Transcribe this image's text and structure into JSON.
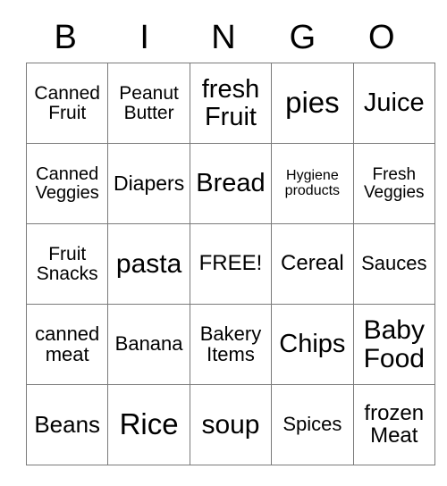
{
  "header": {
    "letters": [
      "B",
      "I",
      "N",
      "G",
      "O"
    ]
  },
  "grid": {
    "rows": [
      [
        {
          "label": "Canned\nFruit",
          "size": "fs-21"
        },
        {
          "label": "Peanut\nButter",
          "size": "fs-21"
        },
        {
          "label": "fresh\nFruit",
          "size": "fs-29"
        },
        {
          "label": "pies",
          "size": "fs-33"
        },
        {
          "label": "Juice",
          "size": "fs-29"
        }
      ],
      [
        {
          "label": "Canned\nVeggies",
          "size": "fs-20"
        },
        {
          "label": "Diapers",
          "size": "fs-23"
        },
        {
          "label": "Bread",
          "size": "fs-29"
        },
        {
          "label": "Hygiene\nproducts",
          "size": "fs-16"
        },
        {
          "label": "Fresh\nVeggies",
          "size": "fs-19"
        }
      ],
      [
        {
          "label": "Fruit\nSnacks",
          "size": "fs-21"
        },
        {
          "label": "pasta",
          "size": "fs-30"
        },
        {
          "label": "FREE!",
          "size": "fs-24"
        },
        {
          "label": "Cereal",
          "size": "fs-24"
        },
        {
          "label": "Sauces",
          "size": "fs-22"
        }
      ],
      [
        {
          "label": "canned\nmeat",
          "size": "fs-22"
        },
        {
          "label": "Banana",
          "size": "fs-22"
        },
        {
          "label": "Bakery\nItems",
          "size": "fs-22"
        },
        {
          "label": "Chips",
          "size": "fs-29"
        },
        {
          "label": "Baby\nFood",
          "size": "fs-30"
        }
      ],
      [
        {
          "label": "Beans",
          "size": "fs-26"
        },
        {
          "label": "Rice",
          "size": "fs-33"
        },
        {
          "label": "soup",
          "size": "fs-30"
        },
        {
          "label": "Spices",
          "size": "fs-22"
        },
        {
          "label": "frozen\nMeat",
          "size": "fs-24"
        }
      ]
    ]
  },
  "colors": {
    "border": "#7a7a7a",
    "text": "#000000",
    "background": "#ffffff"
  }
}
